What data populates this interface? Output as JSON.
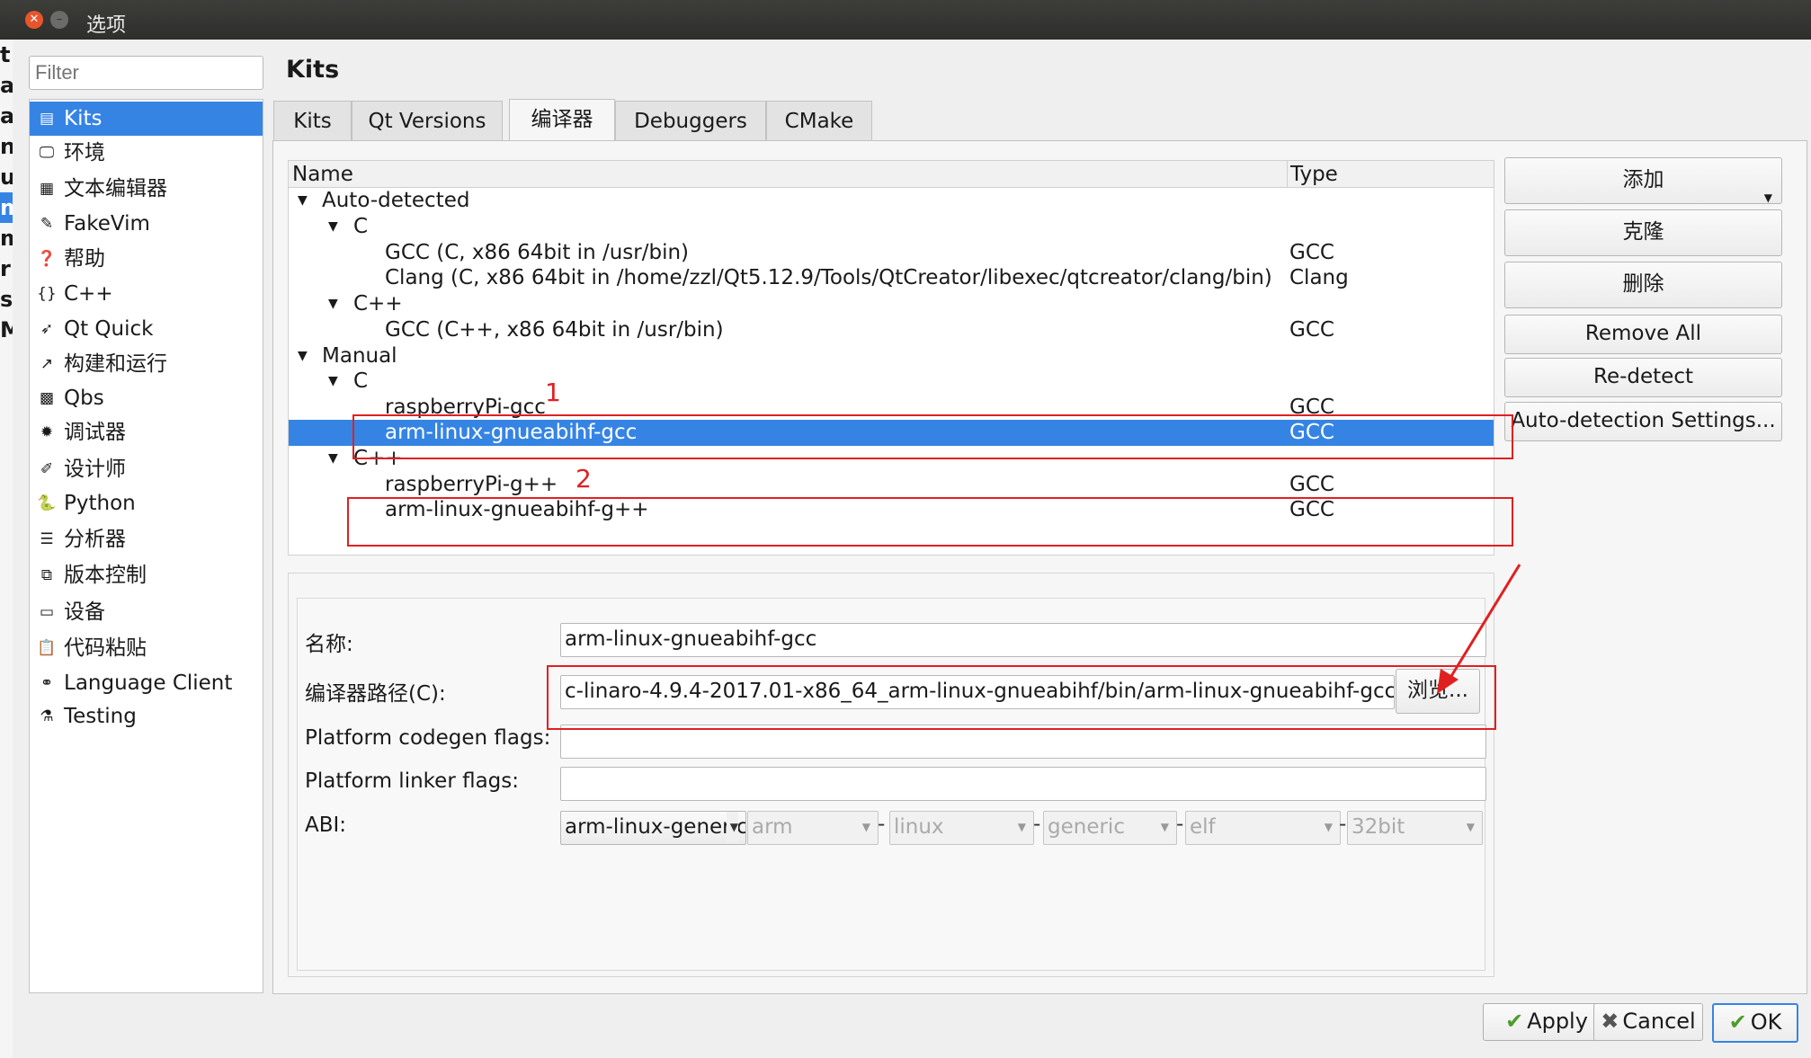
{
  "window": {
    "title": "选项"
  },
  "left_strip": [
    "t",
    "a",
    "a",
    "n",
    "u",
    "m",
    "m",
    "r",
    "s",
    "M"
  ],
  "filter": {
    "placeholder": "Filter"
  },
  "nav": {
    "items": [
      {
        "icon": "kits-icon",
        "glyph": "▤",
        "label": "Kits",
        "selected": true
      },
      {
        "icon": "monitor-icon",
        "glyph": "🖵",
        "label": "环境"
      },
      {
        "icon": "text-editor-icon",
        "glyph": "▦",
        "label": "文本编辑器"
      },
      {
        "icon": "fakevim-icon",
        "glyph": "✎",
        "label": "FakeVim"
      },
      {
        "icon": "help-icon",
        "glyph": "❓",
        "label": "帮助"
      },
      {
        "icon": "cpp-icon",
        "glyph": "{}",
        "label": "C++"
      },
      {
        "icon": "qtquick-icon",
        "glyph": "➶",
        "label": "Qt Quick"
      },
      {
        "icon": "build-run-icon",
        "glyph": "↗",
        "label": "构建和运行"
      },
      {
        "icon": "qbs-icon",
        "glyph": "▩",
        "label": "Qbs"
      },
      {
        "icon": "debugger-icon",
        "glyph": "✹",
        "label": "调试器"
      },
      {
        "icon": "designer-icon",
        "glyph": "✐",
        "label": "设计师"
      },
      {
        "icon": "python-icon",
        "glyph": "🐍",
        "label": "Python"
      },
      {
        "icon": "analyzer-icon",
        "glyph": "☰",
        "label": "分析器"
      },
      {
        "icon": "version-control-icon",
        "glyph": "⧉",
        "label": "版本控制"
      },
      {
        "icon": "devices-icon",
        "glyph": "▭",
        "label": "设备"
      },
      {
        "icon": "code-paste-icon",
        "glyph": "📋",
        "label": "代码粘贴"
      },
      {
        "icon": "language-client-icon",
        "glyph": "⚭",
        "label": "Language Client"
      },
      {
        "icon": "testing-icon",
        "glyph": "⚗",
        "label": "Testing"
      }
    ]
  },
  "page": {
    "heading": "Kits"
  },
  "tabs": [
    {
      "label": "Kits"
    },
    {
      "label": "Qt Versions"
    },
    {
      "label": "编译器",
      "active": true
    },
    {
      "label": "Debuggers"
    },
    {
      "label": "CMake"
    }
  ],
  "tree": {
    "columns": {
      "name": "Name",
      "type": "Type"
    },
    "rows": [
      {
        "level": 0,
        "expanded": true,
        "name": "Auto-detected",
        "type": ""
      },
      {
        "level": 1,
        "expanded": true,
        "name": "C",
        "type": ""
      },
      {
        "level": 2,
        "name": "GCC (C, x86 64bit in /usr/bin)",
        "type": "GCC"
      },
      {
        "level": 2,
        "name": "Clang (C, x86 64bit in /home/zzl/Qt5.12.9/Tools/QtCreator/libexec/qtcreator/clang/bin)",
        "type": "Clang"
      },
      {
        "level": 1,
        "expanded": true,
        "name": "C++",
        "type": ""
      },
      {
        "level": 2,
        "name": "GCC (C++, x86 64bit in /usr/bin)",
        "type": "GCC"
      },
      {
        "level": 0,
        "expanded": true,
        "name": "Manual",
        "type": ""
      },
      {
        "level": 1,
        "expanded": true,
        "name": "C",
        "type": ""
      },
      {
        "level": 2,
        "name": "raspberryPi-gcc",
        "type": "GCC"
      },
      {
        "level": 2,
        "name": "arm-linux-gnueabihf-gcc",
        "type": "GCC",
        "selected": true
      },
      {
        "level": 1,
        "expanded": true,
        "name": "C++",
        "type": ""
      },
      {
        "level": 2,
        "name": "raspberryPi-g++",
        "type": "GCC"
      },
      {
        "level": 2,
        "name": "arm-linux-gnueabihf-g++",
        "type": "GCC"
      }
    ]
  },
  "buttons": {
    "add": "添加",
    "clone": "克隆",
    "delete": "删除",
    "remove_all": "Remove All",
    "redetect": "Re-detect",
    "auto_detection_settings": "Auto-detection Settings..."
  },
  "details": {
    "name_label": "名称:",
    "name_value": "arm-linux-gnueabihf-gcc",
    "path_label": "编译器路径(C):",
    "path_value": "c-linaro-4.9.4-2017.01-x86_64_arm-linux-gnueabihf/bin/arm-linux-gnueabihf-gcc",
    "browse": "浏览...",
    "codegen_label": "Platform codegen flags:",
    "codegen_value": "",
    "linker_label": "Platform linker flags:",
    "linker_value": "",
    "abi_label": "ABI:",
    "abi": {
      "preset": "arm-linux-generic",
      "arch": "arm",
      "os": "linux",
      "flavor": "generic",
      "format": "elf",
      "width": "32bit"
    }
  },
  "annotations": {
    "one": "1",
    "two": "2",
    "color": "#e02020"
  },
  "footer": {
    "apply": "Apply",
    "cancel": "Cancel",
    "ok": "OK"
  },
  "colors": {
    "selection": "#3584e4",
    "titlebar": "#2e2e2c",
    "close": "#e8552c"
  }
}
